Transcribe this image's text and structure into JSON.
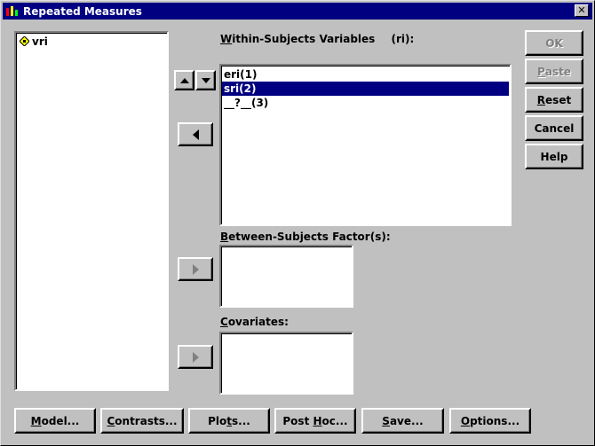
{
  "window": {
    "title": "Repeated Measures"
  },
  "source_list": {
    "items": [
      {
        "label": "vri",
        "icon": "scale-variable-icon"
      }
    ]
  },
  "within": {
    "label_pre": "",
    "label_underline": "W",
    "label_post": "ithin-Subjects Variables",
    "factor": "(ri):",
    "items": [
      {
        "label": "eri(1)",
        "selected": false
      },
      {
        "label": "sri(2)",
        "selected": true
      },
      {
        "label": "__?__(3)",
        "selected": false
      }
    ]
  },
  "between": {
    "label_underline": "B",
    "label_post": "etween-Subjects Factor(s):"
  },
  "covariates": {
    "label_underline": "C",
    "label_post": "ovariates:"
  },
  "side_buttons": {
    "ok": "OK",
    "paste_underline": "P",
    "paste_post": "aste",
    "reset_underline": "R",
    "reset_post": "eset",
    "cancel": "Cancel",
    "help": "Help"
  },
  "bottom_buttons": {
    "model_u": "M",
    "model_post": "odel...",
    "contrasts_pre": "",
    "contrasts_u": "C",
    "contrasts_post": "ontrasts...",
    "plots_pre": "Plo",
    "plots_u": "t",
    "plots_post": "s...",
    "posthoc_pre": "Post ",
    "posthoc_u": "H",
    "posthoc_post": "oc...",
    "save_u": "S",
    "save_post": "ave...",
    "options_u": "O",
    "options_post": "ptions..."
  }
}
